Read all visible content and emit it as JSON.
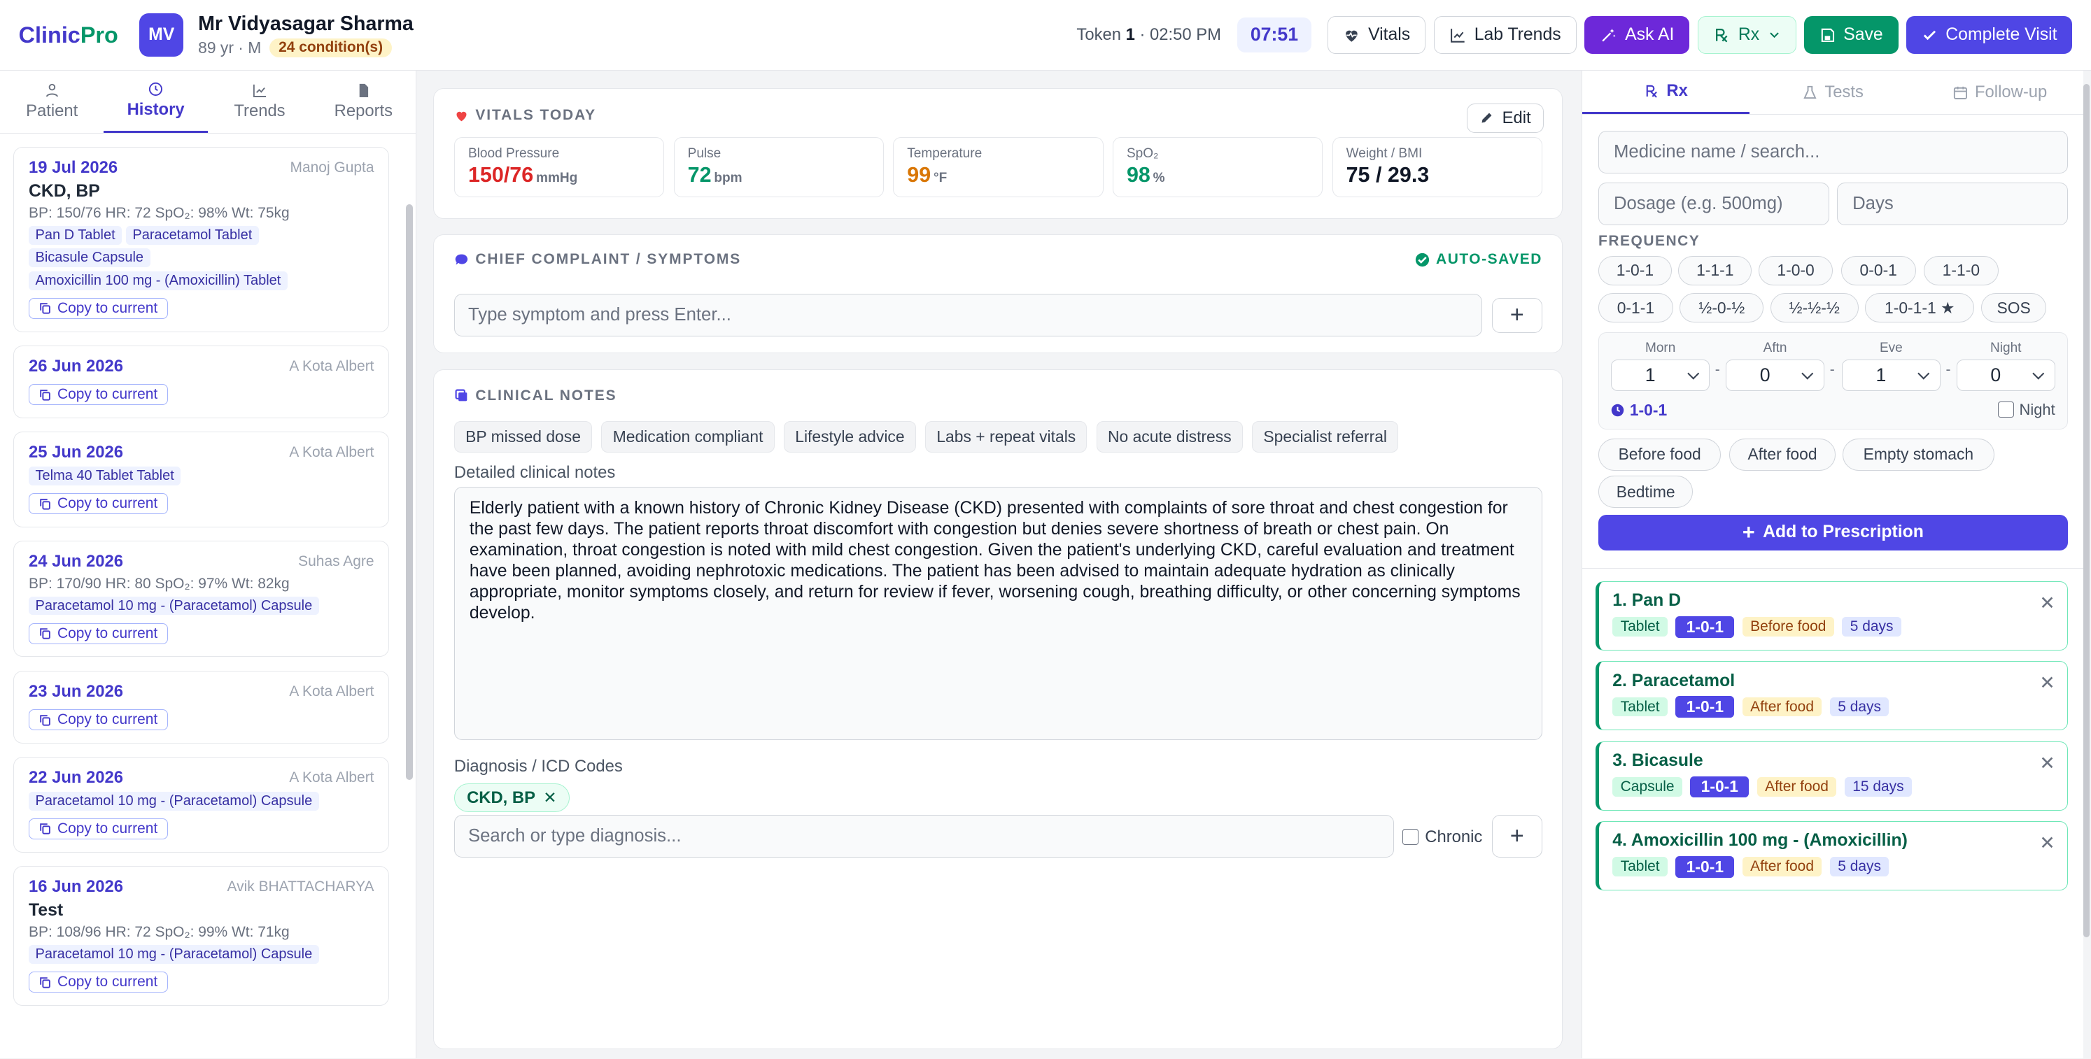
{
  "header": {
    "logo_a": "Clinic",
    "logo_b": "Pro",
    "avatar": "MV",
    "patient_name": "Mr Vidyasagar Sharma",
    "patient_meta": "89 yr · M",
    "conditions": "24 condition(s)",
    "token_label": "Token",
    "token_num": "1",
    "token_time": "02:50 PM",
    "timer": "07:51",
    "buttons": {
      "vitals": "Vitals",
      "lab_trends": "Lab Trends",
      "ask_ai": "Ask AI",
      "rx": "Rx",
      "save": "Save",
      "complete": "Complete Visit"
    }
  },
  "left_tabs": [
    "Patient",
    "History",
    "Trends",
    "Reports"
  ],
  "history": [
    {
      "date": "19 Jul 2026",
      "doctor": "Manoj Gupta",
      "dx": "CKD, BP",
      "vitals": "BP: 150/76   HR: 72   SpO₂: 98%   Wt: 75kg",
      "meds": [
        "Pan D Tablet",
        "Paracetamol Tablet",
        "Bicasule Capsule",
        "Amoxicillin 100 mg - (Amoxicillin) Tablet"
      ]
    },
    {
      "date": "26 Jun 2026",
      "doctor": "A Kota Albert",
      "dx": "",
      "vitals": "",
      "meds": []
    },
    {
      "date": "25 Jun 2026",
      "doctor": "A Kota Albert",
      "dx": "",
      "vitals": "",
      "meds": [
        "Telma 40 Tablet Tablet"
      ]
    },
    {
      "date": "24 Jun 2026",
      "doctor": "Suhas Agre",
      "dx": "",
      "vitals": "BP: 170/90   HR: 80   SpO₂: 97%   Wt: 82kg",
      "meds": [
        "Paracetamol 10 mg - (Paracetamol) Capsule"
      ]
    },
    {
      "date": "23 Jun 2026",
      "doctor": "A Kota Albert",
      "dx": "",
      "vitals": "",
      "meds": []
    },
    {
      "date": "22 Jun 2026",
      "doctor": "A Kota Albert",
      "dx": "",
      "vitals": "",
      "meds": [
        "Paracetamol 10 mg - (Paracetamol) Capsule"
      ]
    },
    {
      "date": "16 Jun 2026",
      "doctor": "Avik BHATTACHARYA",
      "dx": "Test",
      "vitals": "BP: 108/96   HR: 72   SpO₂: 99%   Wt: 71kg",
      "meds": [
        "Paracetamol 10 mg - (Paracetamol) Capsule"
      ]
    }
  ],
  "copy_label": "Copy to current",
  "vitals_card": {
    "title": "VITALS TODAY",
    "edit": "Edit",
    "items": [
      {
        "label": "Blood Pressure",
        "value": "150/76",
        "unit": "mmHg",
        "color": "#dc2626"
      },
      {
        "label": "Pulse",
        "value": "72",
        "unit": "bpm",
        "color": "#059669"
      },
      {
        "label": "Temperature",
        "value": "99",
        "unit": "°F",
        "color": "#d97706"
      },
      {
        "label": "SpO₂",
        "value": "98",
        "unit": "%",
        "color": "#059669"
      },
      {
        "label": "Weight / BMI",
        "value": "75 / 29.3",
        "unit": "",
        "color": "#111827"
      }
    ]
  },
  "complaint_card": {
    "title": "CHIEF COMPLAINT / SYMPTOMS",
    "autosaved": "AUTO-SAVED",
    "placeholder": "Type symptom and press Enter..."
  },
  "notes_card": {
    "title": "CLINICAL NOTES",
    "chips": [
      "BP missed dose",
      "Medication compliant",
      "Lifestyle advice",
      "Labs + repeat vitals",
      "No acute distress",
      "Specialist referral"
    ],
    "detail_label": "Detailed clinical notes",
    "text": "Elderly patient with a known history of Chronic Kidney Disease (CKD) presented with complaints of sore throat and chest congestion for the past few days. The patient reports throat discomfort with congestion but denies severe shortness of breath or chest pain. On examination, throat congestion is noted with mild chest congestion. Given the patient's underlying CKD, careful evaluation and treatment have been planned, avoiding nephrotoxic medications. The patient has been advised to maintain adequate hydration as clinically appropriate, monitor symptoms closely, and return for review if fever, worsening cough, breathing difficulty, or other concerning symptoms develop.",
    "dx_label": "Diagnosis / ICD Codes",
    "dx_chip": "CKD, BP",
    "dx_placeholder": "Search or type diagnosis...",
    "chronic": "Chronic"
  },
  "right_tabs": [
    "Rx",
    "Tests",
    "Follow-up"
  ],
  "rx_form": {
    "medicine_placeholder": "Medicine name / search...",
    "dosage_placeholder": "Dosage (e.g. 500mg)",
    "days_placeholder": "Days",
    "frequency_label": "FREQUENCY",
    "freq_row1": [
      "1-0-1",
      "1-1-1",
      "1-0-0",
      "0-0-1",
      "1-1-0"
    ],
    "freq_row2": [
      "0-1-1",
      "½-0-½",
      "½-½-½",
      "1-0-1-1 ★",
      "SOS"
    ],
    "custom": {
      "labels": [
        "Morn",
        "Aftn",
        "Eve",
        "Night"
      ],
      "values": [
        "1",
        "0",
        "1",
        "0"
      ],
      "result": "1-0-1",
      "night": "Night"
    },
    "food": [
      "Before food",
      "After food",
      "Empty stomach",
      "Bedtime"
    ],
    "add": "Add to Prescription"
  },
  "prescriptions": [
    {
      "name": "1. Pan D",
      "form": "Tablet",
      "dose": "1-0-1",
      "food": "Before food",
      "days": "5 days"
    },
    {
      "name": "2. Paracetamol",
      "form": "Tablet",
      "dose": "1-0-1",
      "food": "After food",
      "days": "5 days"
    },
    {
      "name": "3. Bicasule",
      "form": "Capsule",
      "dose": "1-0-1",
      "food": "After food",
      "days": "15 days"
    },
    {
      "name": "4. Amoxicillin 100 mg - (Amoxicillin)",
      "form": "Tablet",
      "dose": "1-0-1",
      "food": "After food",
      "days": "5 days"
    }
  ]
}
